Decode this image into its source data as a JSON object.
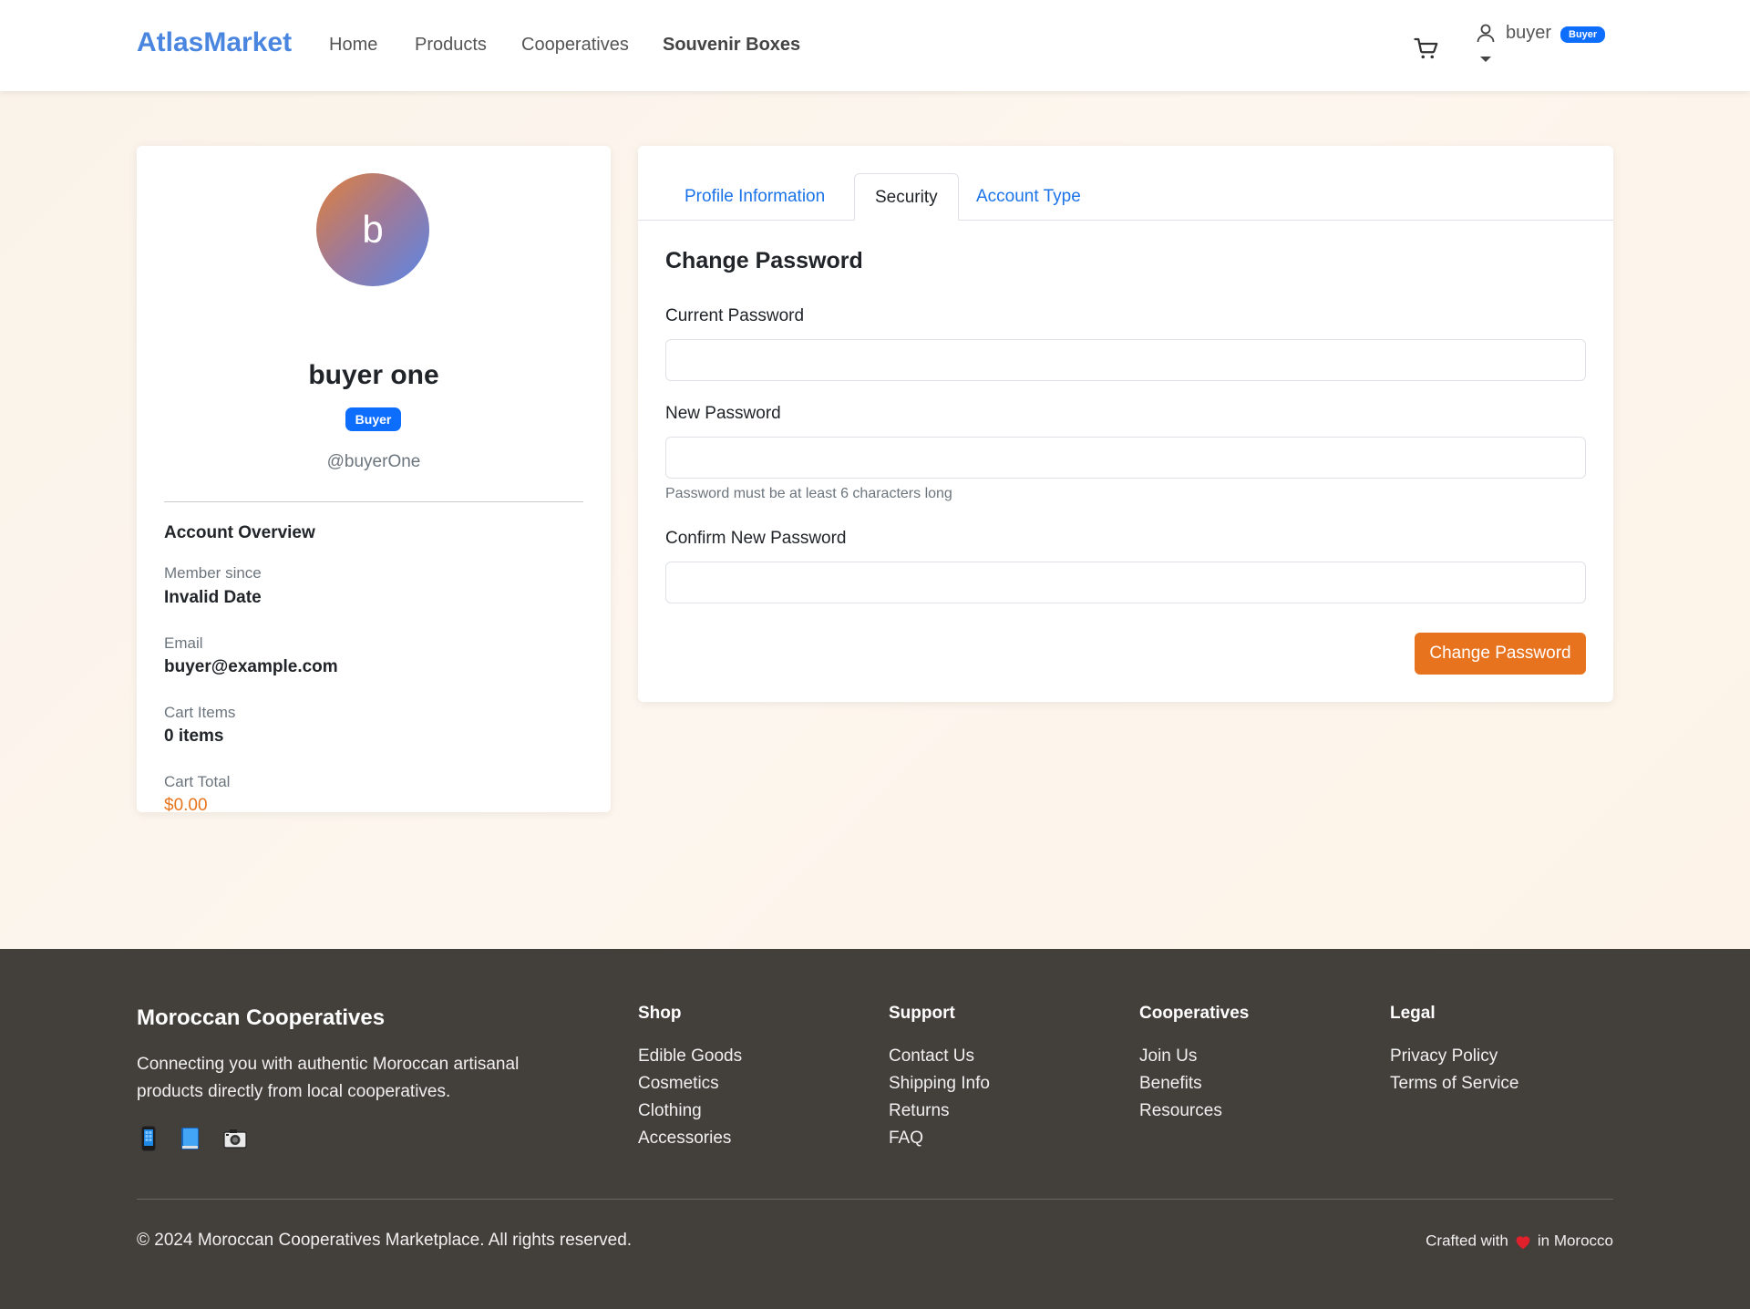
{
  "nav": {
    "brand": "AtlasMarket",
    "links": [
      "Home",
      "Products",
      "Cooperatives",
      "Souvenir Boxes"
    ],
    "user_name": "buyer",
    "user_badge": "Buyer"
  },
  "profile": {
    "avatar_letter": "b",
    "name": "buyer one",
    "badge": "Buyer",
    "handle": "@buyerOne",
    "overview_title": "Account Overview",
    "fields": [
      {
        "label": "Member since",
        "value": "Invalid Date"
      },
      {
        "label": "Email",
        "value": "buyer@example.com"
      },
      {
        "label": "Cart Items",
        "value": "0 items"
      },
      {
        "label": "Cart Total",
        "value": "$0.00"
      }
    ]
  },
  "settings": {
    "tabs": [
      "Profile Information",
      "Security",
      "Account Type"
    ],
    "active_tab": "Security",
    "section_title": "Change Password",
    "current_password_label": "Current Password",
    "new_password_label": "New Password",
    "new_password_help": "Password must be at least 6 characters long",
    "confirm_password_label": "Confirm New Password",
    "current_password_value": "",
    "new_password_value": "",
    "confirm_password_value": "",
    "submit_label": "Change Password"
  },
  "footer": {
    "brand": "Moroccan Cooperatives",
    "description": "Connecting you with authentic Moroccan artisanal products directly from local cooperatives.",
    "social_icons": [
      "mobile-phone-icon",
      "book-icon",
      "camera-icon"
    ],
    "columns": [
      {
        "title": "Shop",
        "links": [
          "Edible Goods",
          "Cosmetics",
          "Clothing",
          "Accessories"
        ]
      },
      {
        "title": "Support",
        "links": [
          "Contact Us",
          "Shipping Info",
          "Returns",
          "FAQ"
        ]
      },
      {
        "title": "Cooperatives",
        "links": [
          "Join Us",
          "Benefits",
          "Resources"
        ]
      },
      {
        "title": "Legal",
        "links": [
          "Privacy Policy",
          "Terms of Service"
        ]
      }
    ],
    "copyright": "© 2024 Moroccan Cooperatives Marketplace. All rights reserved.",
    "crafted_before": "Crafted with",
    "crafted_after": "in Morocco"
  },
  "colors": {
    "brand_blue": "#4a86e0",
    "accent_orange": "#e8731f",
    "badge_blue": "#0d6efd",
    "footer_bg": "#433f3b"
  }
}
